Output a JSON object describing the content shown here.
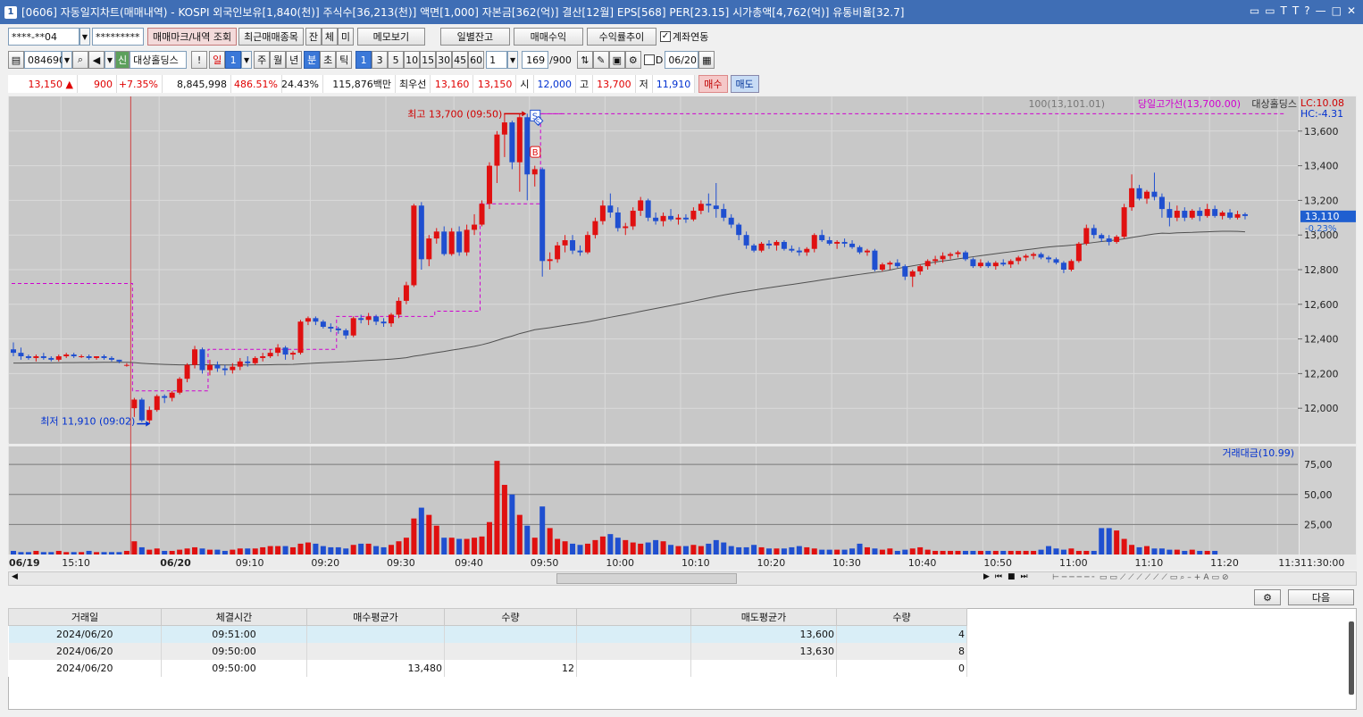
{
  "window": {
    "number": "1",
    "title": "[0606] 자동일지차트(매매내역) - KOSPI 외국인보유[1,840(천)] 주식수[36,213(천)] 액면[1,000] 자본금[362(억)] 결산[12월] EPS[568] PER[23.15] 시가총액[4,762(억)] 유통비율[32.7]",
    "controls": [
      "▭",
      "▭",
      "T",
      "T",
      "?",
      "—",
      "□",
      "✕"
    ]
  },
  "toolbar1": {
    "account": "****-**04",
    "password": "*********",
    "trade_mark_btn": "매매마크/내역 조회",
    "recent_btn": "최근매매종목",
    "jan": "잔",
    "che": "체",
    "mi": "미",
    "memo_btn": "메모보기",
    "daily_balance_btn": "일별잔고",
    "trade_profit_btn": "매매수익",
    "return_trend_btn": "수익률추이",
    "link_check": "계좌연동"
  },
  "toolbar2": {
    "code": "084690",
    "sin": "신",
    "stock_name": "대상홀딩스",
    "excl": "!",
    "periods": [
      "일",
      "1",
      "주",
      "월",
      "년",
      "분",
      "초",
      "틱"
    ],
    "minutes": [
      "1",
      "3",
      "5",
      "10",
      "15",
      "30",
      "45",
      "60"
    ],
    "count_sel": "1",
    "bars": "169",
    "bars_total": "/900",
    "d_label": "D",
    "date": "06/20"
  },
  "pricebar": {
    "price": "13,150",
    "arrow": "▲",
    "change": "900",
    "pct": "+7.35%",
    "volume": "8,845,998",
    "vol_ratio": "486.51%",
    "turnover": "24.43%",
    "amount": "115,876백만",
    "best_label": "최우선",
    "ask": "13,160",
    "bid": "13,150",
    "open_label": "시",
    "open": "12,000",
    "high_label": "고",
    "high": "13,700",
    "low_label": "저",
    "low": "11,910",
    "buy_btn": "매수",
    "sell_btn": "매도"
  },
  "chart_data": {
    "type": "candlestick",
    "legend": {
      "ma": "100(13,101.01)",
      "dayhigh": "당일고가선(13,700.00)",
      "name": "대상홀딩스"
    },
    "lc": "LC:10.08",
    "hc": "HC:-4.31",
    "y_ticks": [
      "13,600",
      "13,400",
      "13,200",
      "13,000",
      "12,800",
      "12,600",
      "12,400",
      "12,200",
      "12,000"
    ],
    "y_range": [
      11800,
      13800
    ],
    "current": "13,110",
    "current_pct": "-0.23%",
    "high_label": "최고 13,700 (09:50)",
    "low_label": "최저 11,910 (09:02)",
    "vol_legend": "거래대금(10.99)",
    "vol_ticks": [
      "75,00",
      "50,00",
      "25,00"
    ],
    "x_ticks": [
      "06/19",
      "15:10",
      "06/20",
      "09:10",
      "09:20",
      "09:30",
      "09:40",
      "09:50",
      "10:00",
      "10:10",
      "10:20",
      "10:30",
      "10:40",
      "10:50",
      "11:00",
      "11:10",
      "11:20",
      "11:3",
      "11:30:00"
    ],
    "candles": [
      [
        12340,
        12380,
        12300,
        12320
      ],
      [
        12320,
        12350,
        12280,
        12300
      ],
      [
        12300,
        12310,
        12280,
        12290
      ],
      [
        12290,
        12310,
        12270,
        12300
      ],
      [
        12300,
        12320,
        12280,
        12290
      ],
      [
        12290,
        12300,
        12270,
        12280
      ],
      [
        12280,
        12310,
        12270,
        12300
      ],
      [
        12300,
        12320,
        12290,
        12310
      ],
      [
        12310,
        12320,
        12290,
        12300
      ],
      [
        12300,
        12310,
        12290,
        12300
      ],
      [
        12300,
        12310,
        12280,
        12290
      ],
      [
        12290,
        12300,
        12280,
        12300
      ],
      [
        12300,
        12310,
        12280,
        12290
      ],
      [
        12290,
        12300,
        12270,
        12280
      ],
      [
        12280,
        12280,
        12260,
        12270
      ],
      [
        12250,
        12260,
        12240,
        12250
      ],
      [
        12000,
        12060,
        11950,
        12050
      ],
      [
        12050,
        12060,
        11920,
        11930
      ],
      [
        11930,
        12010,
        11910,
        11990
      ],
      [
        11990,
        12080,
        11980,
        12070
      ],
      [
        12070,
        12080,
        12030,
        12060
      ],
      [
        12060,
        12100,
        12040,
        12090
      ],
      [
        12090,
        12180,
        12080,
        12170
      ],
      [
        12170,
        12260,
        12150,
        12250
      ],
      [
        12250,
        12360,
        12230,
        12340
      ],
      [
        12340,
        12350,
        12200,
        12220
      ],
      [
        12220,
        12280,
        12190,
        12250
      ],
      [
        12250,
        12270,
        12210,
        12230
      ],
      [
        12230,
        12250,
        12190,
        12220
      ],
      [
        12220,
        12260,
        12200,
        12240
      ],
      [
        12240,
        12290,
        12220,
        12270
      ],
      [
        12270,
        12300,
        12240,
        12260
      ],
      [
        12260,
        12300,
        12250,
        12290
      ],
      [
        12290,
        12320,
        12270,
        12300
      ],
      [
        12300,
        12340,
        12290,
        12320
      ],
      [
        12320,
        12370,
        12300,
        12350
      ],
      [
        12350,
        12360,
        12280,
        12310
      ],
      [
        12310,
        12330,
        12280,
        12320
      ],
      [
        12320,
        12510,
        12310,
        12500
      ],
      [
        12500,
        12530,
        12480,
        12520
      ],
      [
        12520,
        12530,
        12480,
        12500
      ],
      [
        12500,
        12510,
        12460,
        12470
      ],
      [
        12470,
        12490,
        12440,
        12460
      ],
      [
        12460,
        12470,
        12430,
        12450
      ],
      [
        12450,
        12460,
        12400,
        12420
      ],
      [
        12420,
        12530,
        12410,
        12520
      ],
      [
        12520,
        12540,
        12490,
        12510
      ],
      [
        12510,
        12550,
        12480,
        12530
      ],
      [
        12530,
        12540,
        12480,
        12500
      ],
      [
        12500,
        12520,
        12470,
        12490
      ],
      [
        12490,
        12550,
        12470,
        12540
      ],
      [
        12540,
        12640,
        12520,
        12620
      ],
      [
        12620,
        12730,
        12600,
        12710
      ],
      [
        12710,
        13180,
        12700,
        13170
      ],
      [
        13170,
        13190,
        12800,
        12860
      ],
      [
        12860,
        13000,
        12820,
        12980
      ],
      [
        12980,
        13040,
        12950,
        13020
      ],
      [
        13020,
        13050,
        12880,
        12890
      ],
      [
        12890,
        13040,
        12880,
        13020
      ],
      [
        13020,
        13050,
        12880,
        12900
      ],
      [
        12900,
        13060,
        12880,
        13030
      ],
      [
        13030,
        13120,
        13000,
        13060
      ],
      [
        13060,
        13200,
        13050,
        13180
      ],
      [
        13180,
        13420,
        13150,
        13400
      ],
      [
        13400,
        13600,
        13300,
        13580
      ],
      [
        13580,
        13700,
        13450,
        13650
      ],
      [
        13650,
        13660,
        13380,
        13420
      ],
      [
        13420,
        13700,
        13250,
        13680
      ],
      [
        13680,
        13700,
        13200,
        13350
      ],
      [
        13350,
        13400,
        13280,
        13380
      ],
      [
        13380,
        13390,
        12760,
        12850
      ],
      [
        12850,
        12900,
        12800,
        12860
      ],
      [
        12860,
        12960,
        12840,
        12940
      ],
      [
        12940,
        13000,
        12900,
        12970
      ],
      [
        12970,
        13000,
        12890,
        12910
      ],
      [
        12910,
        12940,
        12880,
        12900
      ],
      [
        12900,
        13020,
        12890,
        13000
      ],
      [
        13000,
        13100,
        12980,
        13080
      ],
      [
        13080,
        13200,
        13060,
        13170
      ],
      [
        13170,
        13240,
        13100,
        13130
      ],
      [
        13130,
        13160,
        13020,
        13040
      ],
      [
        13040,
        13070,
        13000,
        13050
      ],
      [
        13050,
        13160,
        13030,
        13140
      ],
      [
        13140,
        13220,
        13110,
        13200
      ],
      [
        13200,
        13210,
        13080,
        13100
      ],
      [
        13100,
        13130,
        13060,
        13080
      ],
      [
        13080,
        13130,
        13050,
        13110
      ],
      [
        13110,
        13150,
        13080,
        13090
      ],
      [
        13090,
        13120,
        13060,
        13100
      ],
      [
        13100,
        13120,
        13070,
        13090
      ],
      [
        13090,
        13160,
        13080,
        13140
      ],
      [
        13140,
        13200,
        13120,
        13180
      ],
      [
        13180,
        13240,
        13130,
        13170
      ],
      [
        13170,
        13300,
        13100,
        13150
      ],
      [
        13150,
        13180,
        13080,
        13100
      ],
      [
        13100,
        13120,
        13040,
        13060
      ],
      [
        13060,
        13070,
        12970,
        13000
      ],
      [
        13000,
        13020,
        12920,
        12940
      ],
      [
        12940,
        12950,
        12900,
        12910
      ],
      [
        12910,
        12960,
        12900,
        12950
      ],
      [
        12950,
        12970,
        12920,
        12940
      ],
      [
        12940,
        12970,
        12910,
        12960
      ],
      [
        12960,
        12970,
        12910,
        12920
      ],
      [
        12920,
        12940,
        12900,
        12910
      ],
      [
        12910,
        12930,
        12880,
        12900
      ],
      [
        12900,
        12930,
        12880,
        12920
      ],
      [
        12920,
        13010,
        12900,
        13000
      ],
      [
        13000,
        13030,
        12960,
        12970
      ],
      [
        12970,
        12990,
        12940,
        12950
      ],
      [
        12950,
        12970,
        12920,
        12960
      ],
      [
        12960,
        12980,
        12930,
        12950
      ],
      [
        12950,
        12970,
        12920,
        12930
      ],
      [
        12930,
        12940,
        12890,
        12900
      ],
      [
        12900,
        12920,
        12880,
        12910
      ],
      [
        12910,
        12920,
        12790,
        12800
      ],
      [
        12800,
        12840,
        12790,
        12830
      ],
      [
        12830,
        12850,
        12800,
        12840
      ],
      [
        12840,
        12860,
        12810,
        12820
      ],
      [
        12820,
        12830,
        12740,
        12760
      ],
      [
        12760,
        12800,
        12700,
        12790
      ],
      [
        12790,
        12830,
        12770,
        12820
      ],
      [
        12820,
        12860,
        12800,
        12850
      ],
      [
        12850,
        12880,
        12830,
        12860
      ],
      [
        12860,
        12900,
        12840,
        12880
      ],
      [
        12880,
        12900,
        12860,
        12890
      ],
      [
        12890,
        12910,
        12870,
        12900
      ],
      [
        12900,
        12910,
        12850,
        12860
      ],
      [
        12860,
        12870,
        12810,
        12820
      ],
      [
        12820,
        12860,
        12810,
        12840
      ],
      [
        12840,
        12850,
        12810,
        12820
      ],
      [
        12820,
        12850,
        12800,
        12840
      ],
      [
        12840,
        12860,
        12820,
        12830
      ],
      [
        12830,
        12860,
        12810,
        12850
      ],
      [
        12850,
        12880,
        12830,
        12870
      ],
      [
        12870,
        12890,
        12850,
        12880
      ],
      [
        12880,
        12900,
        12860,
        12890
      ],
      [
        12890,
        12900,
        12860,
        12870
      ],
      [
        12870,
        12880,
        12840,
        12860
      ],
      [
        12860,
        12870,
        12830,
        12840
      ],
      [
        12840,
        12850,
        12780,
        12800
      ],
      [
        12800,
        12860,
        12790,
        12850
      ],
      [
        12850,
        12960,
        12840,
        12950
      ],
      [
        12950,
        13060,
        12940,
        13040
      ],
      [
        13040,
        13060,
        12980,
        13000
      ],
      [
        13000,
        13010,
        12960,
        12980
      ],
      [
        12980,
        13000,
        12940,
        12960
      ],
      [
        12960,
        13000,
        12950,
        12990
      ],
      [
        12990,
        13180,
        12980,
        13160
      ],
      [
        13160,
        13350,
        13140,
        13270
      ],
      [
        13270,
        13290,
        13200,
        13210
      ],
      [
        13210,
        13260,
        13180,
        13250
      ],
      [
        13250,
        13360,
        13200,
        13220
      ],
      [
        13220,
        13240,
        13100,
        13150
      ],
      [
        13150,
        13190,
        13050,
        13100
      ],
      [
        13100,
        13170,
        13080,
        13140
      ],
      [
        13140,
        13160,
        13080,
        13100
      ],
      [
        13100,
        13150,
        13090,
        13140
      ],
      [
        13140,
        13160,
        13080,
        13110
      ],
      [
        13110,
        13180,
        13100,
        13150
      ],
      [
        13150,
        13170,
        13100,
        13110
      ],
      [
        13110,
        13140,
        13090,
        13130
      ],
      [
        13130,
        13150,
        13090,
        13100
      ],
      [
        13100,
        13140,
        13090,
        13120
      ],
      [
        13120,
        13130,
        13090,
        13110
      ]
    ],
    "volumes": [
      3,
      2,
      2,
      3,
      2,
      2,
      3,
      2,
      2,
      2,
      3,
      2,
      2,
      2,
      2,
      3,
      11,
      6,
      4,
      5,
      3,
      3,
      4,
      5,
      6,
      5,
      4,
      4,
      3,
      4,
      5,
      5,
      5,
      6,
      7,
      7,
      7,
      6,
      9,
      10,
      9,
      7,
      6,
      6,
      5,
      8,
      9,
      9,
      7,
      6,
      8,
      11,
      14,
      30,
      39,
      33,
      24,
      14,
      14,
      13,
      13,
      14,
      15,
      27,
      78,
      58,
      50,
      33,
      24,
      14,
      40,
      22,
      13,
      11,
      9,
      8,
      9,
      12,
      15,
      17,
      14,
      12,
      10,
      9,
      10,
      12,
      11,
      8,
      7,
      7,
      8,
      7,
      9,
      12,
      10,
      7,
      6,
      6,
      8,
      6,
      5,
      5,
      5,
      6,
      7,
      6,
      5,
      4,
      4,
      4,
      4,
      5,
      9,
      6,
      5,
      4,
      5,
      3,
      4,
      5,
      6,
      4,
      3,
      3,
      3,
      3,
      3,
      3,
      3,
      3,
      3,
      3,
      3,
      3,
      3,
      3,
      4,
      7,
      5,
      4,
      5,
      3,
      3,
      3,
      22,
      22,
      20,
      13,
      8,
      6,
      7,
      5,
      5,
      4,
      4,
      3,
      4,
      3,
      3,
      3
    ]
  },
  "scroll_tools": [
    "▶",
    "⏮",
    "■",
    "⏭"
  ],
  "bottom": {
    "gear": "⚙",
    "next_btn": "다음"
  },
  "table": {
    "headers": [
      "거래일",
      "체결시간",
      "매수평균가",
      "수량",
      "",
      "매도평균가",
      "수량"
    ],
    "rows": [
      [
        "2024/06/20",
        "09:51:00",
        "",
        "",
        "",
        "13,600",
        "4"
      ],
      [
        "2024/06/20",
        "09:50:00",
        "",
        "",
        "",
        "13,630",
        "8"
      ],
      [
        "2024/06/20",
        "09:50:00",
        "13,480",
        "12",
        "",
        "",
        "0"
      ]
    ]
  }
}
